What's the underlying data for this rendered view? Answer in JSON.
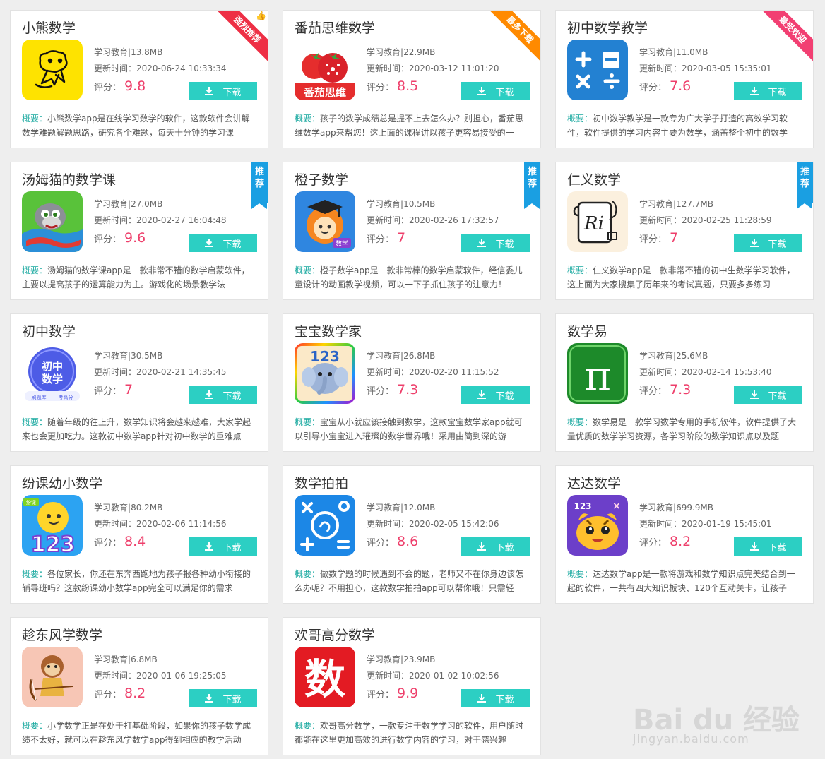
{
  "ui": {
    "meta_sep": "|",
    "update_prefix": "更新时间：",
    "rating_prefix": "评分：",
    "download_label": "下载",
    "summary_label": "概要："
  },
  "apps": [
    {
      "name": "小熊数学",
      "category": "学习教育",
      "size": "13.8MB",
      "updated": "2020-06-24 10:33:34",
      "rating": "9.8",
      "summary": "小熊数学app是在线学习数学的软件，这款软件会讲解数学难题解题思路，研究各个难题，每天十分钟的学习课",
      "badge": {
        "kind": "ribbon",
        "text": "强烈推荐",
        "color": "#ee2f45"
      },
      "icon": "bear-icon"
    },
    {
      "name": "番茄思维数学",
      "category": "学习教育",
      "size": "22.9MB",
      "updated": "2020-03-12 11:01:20",
      "rating": "8.5",
      "summary": "孩子的数学成绩总是提不上去怎么办？别担心，番茄思维数学app来帮您！这上面的课程讲以孩子更容易接受的一",
      "badge": {
        "kind": "ribbon",
        "text": "最多下载",
        "color": "#ff8a00"
      },
      "icon": "tomato-icon",
      "icon_text": "番茄思维"
    },
    {
      "name": "初中数学教学",
      "category": "学习教育",
      "size": "11.0MB",
      "updated": "2020-03-05 15:35:01",
      "rating": "7.6",
      "summary": "初中数学教学是一款专为广大学子打造的高效学习软件，软件提供的学习内容主要为数学，涵盖整个初中的数学",
      "badge": {
        "kind": "ribbon",
        "text": "最受欢迎",
        "color": "#f23f72"
      },
      "icon": "calculator-icon"
    },
    {
      "name": "汤姆猫的数学课",
      "category": "学习教育",
      "size": "27.0MB",
      "updated": "2020-02-27 16:04:48",
      "rating": "9.6",
      "summary": "汤姆猫的数学课app是一款非常不错的数学启蒙软件，主要以提高孩子的运算能力为主。游戏化的场景教学法",
      "badge": {
        "kind": "tag",
        "text": "推荐"
      },
      "icon": "tom-cat-icon"
    },
    {
      "name": "橙子数学",
      "category": "学习教育",
      "size": "10.5MB",
      "updated": "2020-02-26 17:32:57",
      "rating": "7",
      "summary": "橙子数学app是一款非常棒的数学启蒙软件，经信委儿童设计的动画教学视频，可以一下子抓住孩子的注意力！",
      "badge": {
        "kind": "tag",
        "text": "推荐"
      },
      "icon": "orange-scholar-icon",
      "icon_text": "数学"
    },
    {
      "name": "仁义数学",
      "category": "学习教育",
      "size": "127.7MB",
      "updated": "2020-02-25 11:28:59",
      "rating": "7",
      "summary": "仁义数学app是一款非常不错的初中生数学学习软件，这上面为大家搜集了历年来的考试真题，只要多多练习",
      "badge": {
        "kind": "tag",
        "text": "推荐"
      },
      "icon": "scroll-icon"
    },
    {
      "name": "初中数学",
      "category": "学习教育",
      "size": "30.5MB",
      "updated": "2020-02-21 14:35:45",
      "rating": "7",
      "summary": "随着年级的往上升，数学知识将会越来越难，大家学起来也会更加吃力。这款初中数学app针对初中数学的重难点",
      "badge": null,
      "icon": "junior-math-badge-icon",
      "icon_text": [
        "初中",
        "数学",
        "刷题库",
        "考高分"
      ]
    },
    {
      "name": "宝宝数学家",
      "category": "学习教育",
      "size": "26.8MB",
      "updated": "2020-02-20 11:15:52",
      "rating": "7.3",
      "summary": "宝宝从小就应该接触到数学，这款宝宝数学家app就可以引导小宝宝进入璀璨的数学世界哦！采用由简到深的游",
      "badge": null,
      "icon": "elephant-icon",
      "icon_text": "123"
    },
    {
      "name": "数学易",
      "category": "学习教育",
      "size": "25.6MB",
      "updated": "2020-02-14 15:53:40",
      "rating": "7.3",
      "summary": "数学易是一款学习数学专用的手机软件，软件提供了大量优质的数学学习资源，各学习阶段的数学知识点以及题",
      "badge": null,
      "icon": "pi-icon",
      "icon_text": "π"
    },
    {
      "name": "纷课幼小数学",
      "category": "学习教育",
      "size": "80.2MB",
      "updated": "2020-02-06 11:14:56",
      "rating": "8.4",
      "summary": "各位家长，你还在东奔西跑地为孩子报各种幼小衔接的辅导班吗？这款纷课幼小数学app完全可以满足你的需求",
      "badge": null,
      "icon": "sun-123-icon",
      "icon_text": [
        "纷课",
        "123"
      ]
    },
    {
      "name": "数学拍拍",
      "category": "学习教育",
      "size": "12.0MB",
      "updated": "2020-02-05 15:42:06",
      "rating": "8.6",
      "summary": "做数学题的时候遇到不会的题，老师又不在你身边该怎么办呢？不用担心，这款数学拍拍app可以帮你哦！只需轻",
      "badge": null,
      "icon": "math-camera-icon"
    },
    {
      "name": "达达数学",
      "category": "学习教育",
      "size": "699.9MB",
      "updated": "2020-01-19 15:45:01",
      "rating": "8.2",
      "summary": "达达数学app是一款将游戏和数学知识点完美结合到一起的软件，一共有四大知识板块、120个互动关卡，让孩子",
      "badge": null,
      "icon": "tiger-icon",
      "icon_text": "123"
    },
    {
      "name": "趁东风学数学",
      "category": "学习教育",
      "size": "6.8MB",
      "updated": "2020-01-06 19:25:05",
      "rating": "8.2",
      "summary": "小学数学正是在处于打基础阶段，如果你的孩子数学成绩不太好，就可以在趁东风学数学app得到相应的教学活动",
      "badge": null,
      "icon": "monkey-archer-icon"
    },
    {
      "name": "欢哥高分数学",
      "category": "学习教育",
      "size": "23.9MB",
      "updated": "2020-01-02 10:02:56",
      "rating": "9.9",
      "summary": "欢哥高分数学，一款专注于数学学习的软件，用户随时都能在这里更加高效的进行数学内容的学习，对于感兴趣",
      "badge": null,
      "icon": "shu-character-icon",
      "icon_text": "数"
    }
  ],
  "watermark": {
    "brand": "Bai du 经验",
    "url": "jingyan.baidu.com"
  }
}
